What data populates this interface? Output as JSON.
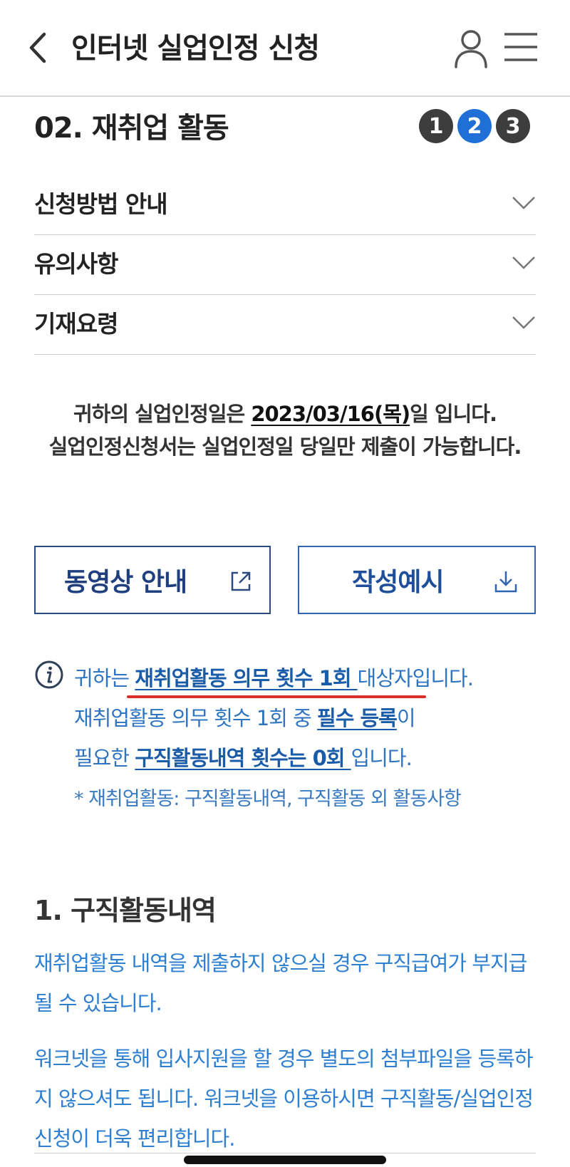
{
  "header": {
    "title": "인터넷 실업인정 신청"
  },
  "step": {
    "title": "02. 재취업 활동",
    "numbers": [
      "1",
      "2",
      "3"
    ],
    "active_index": 1
  },
  "accordion": [
    {
      "label": "신청방법 안내"
    },
    {
      "label": "유의사항"
    },
    {
      "label": "기재요령"
    }
  ],
  "notice": {
    "prefix": "귀하의 실업인정일은 ",
    "date": "2023/03/16(목)",
    "suffix": "일 입니다.",
    "line2": "실업인정신청서는 실업인정일 당일만 제출이 가능합니다."
  },
  "buttons": {
    "video": "동영상 안내",
    "example": "작성예시"
  },
  "info": {
    "l1_prefix": "귀하는 ",
    "l1_strong": "재취업활동 의무 횟수 1회 ",
    "l1_suffix": "대상자입니다.",
    "l2_prefix": "재취업활동 의무 횟수 1회 중 ",
    "l2_strong": "필수 등록",
    "l2_suffix": "이",
    "l3_prefix": "필요한 ",
    "l3_strong": "구직활동내역 횟수는 0회 ",
    "l3_suffix": "입니다.",
    "note": "* 재취업활동: 구직활동내역, 구직활동 외 활동사항"
  },
  "section": {
    "title": "1. 구직활동내역",
    "para1": "재취업활동 내역을 제출하지 않으실 경우 구직급여가 부지급 될 수 있습니다.",
    "para2": "워크넷을 통해 입사지원을 할 경우 별도의 첨부파일을 등록하지 않으셔도 됩니다. 워크넷을 이용하시면 구직활동/실업인정신청이 더욱 편리합니다."
  },
  "colors": {
    "accent": "#1f6fd6",
    "link_text": "#2f74c0",
    "underline_mark": "#d8302a"
  }
}
